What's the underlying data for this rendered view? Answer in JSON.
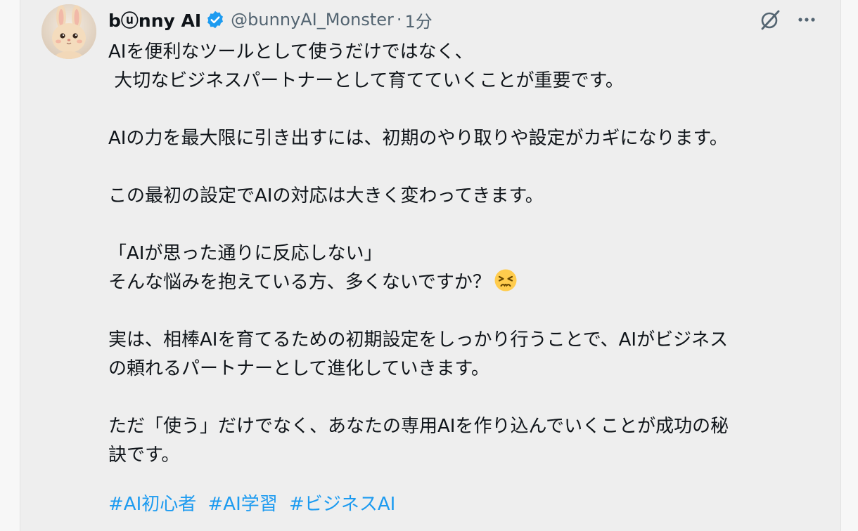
{
  "author": {
    "display_name": "bⓤnny AI",
    "handle": "@bunnyAI_Monster",
    "separator": "·",
    "time": "1分"
  },
  "icons": {
    "avatar": "bunny-avatar",
    "verified": "verified-badge-icon",
    "grok": "grok-icon",
    "more": "more-icon",
    "emoji": "persevering-face-emoji"
  },
  "colors": {
    "card_bg": "#eeeeee",
    "text": "#0f1419",
    "secondary_text": "#536471",
    "accent": "#1d9bf0"
  },
  "tweet": {
    "lines": [
      "AIを便利なツールとして使うだけではなく、",
      " 大切なビジネスパートナーとして育てていくことが重要です。",
      "AIの力を最大限に引き出すには、初期のやり取りや設定がカギになります。",
      "この最初の設定でAIの対応は大きく変わってきます。",
      "「AIが思った通りに反応しない」",
      "そんな悩みを抱えている方、多くないですか？",
      "実は、相棒AIを育てるための初期設定をしっかり行うことで、AIがビジネス",
      "の頼れるパートナーとして進化していきます。",
      "ただ「使う」だけでなく、あなたの専用AIを作り込んでいくことが成功の秘",
      "訣です。"
    ],
    "hashtags": [
      "#AI初心者",
      "#AI学習",
      "#ビジネスAI"
    ]
  }
}
